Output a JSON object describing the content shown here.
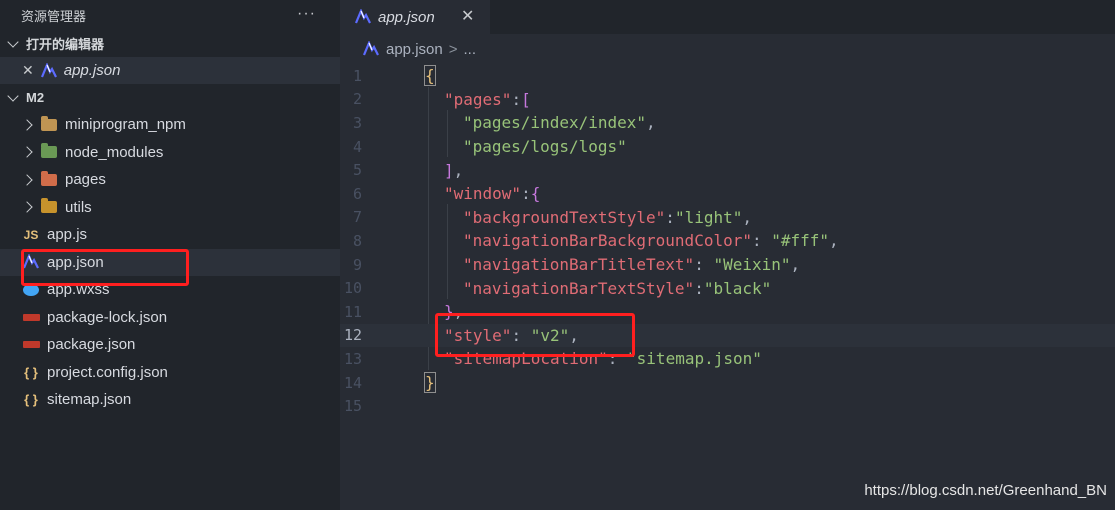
{
  "sidebar": {
    "title": "资源管理器",
    "more": "···",
    "open_editors": {
      "title": "打开的编辑器",
      "items": [
        {
          "close": "✕",
          "label": "app.json"
        }
      ]
    },
    "project": {
      "title": "M2",
      "items": [
        {
          "label": "miniprogram_npm"
        },
        {
          "label": "node_modules"
        },
        {
          "label": "pages"
        },
        {
          "label": "utils"
        },
        {
          "label": "app.js",
          "icon_text": "JS"
        },
        {
          "label": "app.json"
        },
        {
          "label": "app.wxss"
        },
        {
          "label": "package-lock.json"
        },
        {
          "label": "package.json"
        },
        {
          "label": "project.config.json",
          "icon_text": "{ }"
        },
        {
          "label": "sitemap.json",
          "icon_text": "{ }"
        }
      ]
    }
  },
  "editor": {
    "tab": {
      "label": "app.json",
      "close": "✕"
    },
    "breadcrumb": {
      "file": "app.json",
      "sep": ">",
      "more": "..."
    },
    "current_line": 12,
    "lines": [
      {
        "n": "1"
      },
      {
        "n": "2"
      },
      {
        "n": "3"
      },
      {
        "n": "4"
      },
      {
        "n": "5"
      },
      {
        "n": "6"
      },
      {
        "n": "7"
      },
      {
        "n": "8"
      },
      {
        "n": "9"
      },
      {
        "n": "10"
      },
      {
        "n": "11"
      },
      {
        "n": "12"
      },
      {
        "n": "13"
      },
      {
        "n": "14"
      },
      {
        "n": "15"
      }
    ],
    "tokens": {
      "l1_brace": "{",
      "l2_key": "\"pages\"",
      "l2_punc": ":",
      "l2_brk": "[",
      "l3_str": "\"pages/index/index\"",
      "l3_punc": ",",
      "l4_str": "\"pages/logs/logs\"",
      "l5_brk": "]",
      "l5_punc": ",",
      "l6_key": "\"window\"",
      "l6_punc": ":",
      "l6_brace": "{",
      "l7_key": "\"backgroundTextStyle\"",
      "l7_punc": ":",
      "l7_str": "\"light\"",
      "l7_punc2": ",",
      "l8_key": "\"navigationBarBackgroundColor\"",
      "l8_punc": ": ",
      "l8_str": "\"#fff\"",
      "l8_punc2": ",",
      "l9_key": "\"navigationBarTitleText\"",
      "l9_punc": ": ",
      "l9_str": "\"Weixin\"",
      "l9_punc2": ",",
      "l10_key": "\"navigationBarTextStyle\"",
      "l10_punc": ":",
      "l10_str": "\"black\"",
      "l11_brace": "}",
      "l11_punc": ",",
      "l12_key": "\"style\"",
      "l12_punc": ": ",
      "l12_str": "\"v2\"",
      "l12_punc2": ",",
      "l13_key": "\"sitemapLocation\"",
      "l13_punc": ": ",
      "l13_str": "\"sitemap.json\"",
      "l14_brace": "}"
    }
  },
  "watermark": "https://blog.csdn.net/Greenhand_BN",
  "colors": {
    "highlight_box": "#ff1f1f",
    "key": "#e06c75",
    "string": "#98c379"
  }
}
